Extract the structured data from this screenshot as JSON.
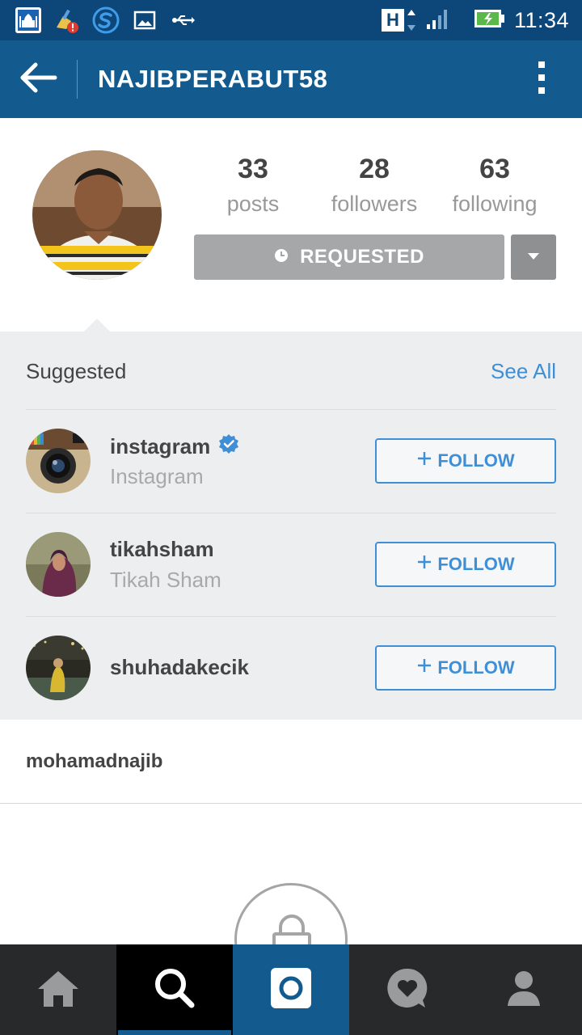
{
  "status_bar": {
    "time": "11:34",
    "network_letter": "H",
    "icons": [
      "mosque-app-icon",
      "cleaner-alert-icon",
      "s-app-icon",
      "image-icon",
      "usb-icon",
      "signal-icon",
      "battery-charging-icon"
    ]
  },
  "appbar": {
    "title": "NAJIBPERABUT58",
    "back_icon": "arrow-left-icon",
    "menu_icon": "more-vertical-icon"
  },
  "profile": {
    "stats": [
      {
        "value": "33",
        "label": "posts"
      },
      {
        "value": "28",
        "label": "followers"
      },
      {
        "value": "63",
        "label": "following"
      }
    ],
    "requested_label": "REQUESTED",
    "full_name": "mohamadnajib"
  },
  "suggested": {
    "title": "Suggested",
    "see_all": "See All",
    "items": [
      {
        "username": "instagram",
        "name": "Instagram",
        "verified": true,
        "follow_label": "FOLLOW"
      },
      {
        "username": "tikahsham",
        "name": "Tikah Sham",
        "verified": false,
        "follow_label": "FOLLOW"
      },
      {
        "username": "shuhadakecik",
        "name": "",
        "verified": false,
        "follow_label": "FOLLOW"
      }
    ]
  },
  "bottom_nav": {
    "tabs": [
      "home-icon",
      "search-icon",
      "camera-icon",
      "activity-icon",
      "profile-icon"
    ],
    "active": "search-icon"
  },
  "colors": {
    "status_bar": "#0d4679",
    "app_bar": "#135a8e",
    "accent_blue": "#3f8fd6",
    "requested_gray": "#a6a7a9",
    "panel_bg": "#edeef0"
  }
}
